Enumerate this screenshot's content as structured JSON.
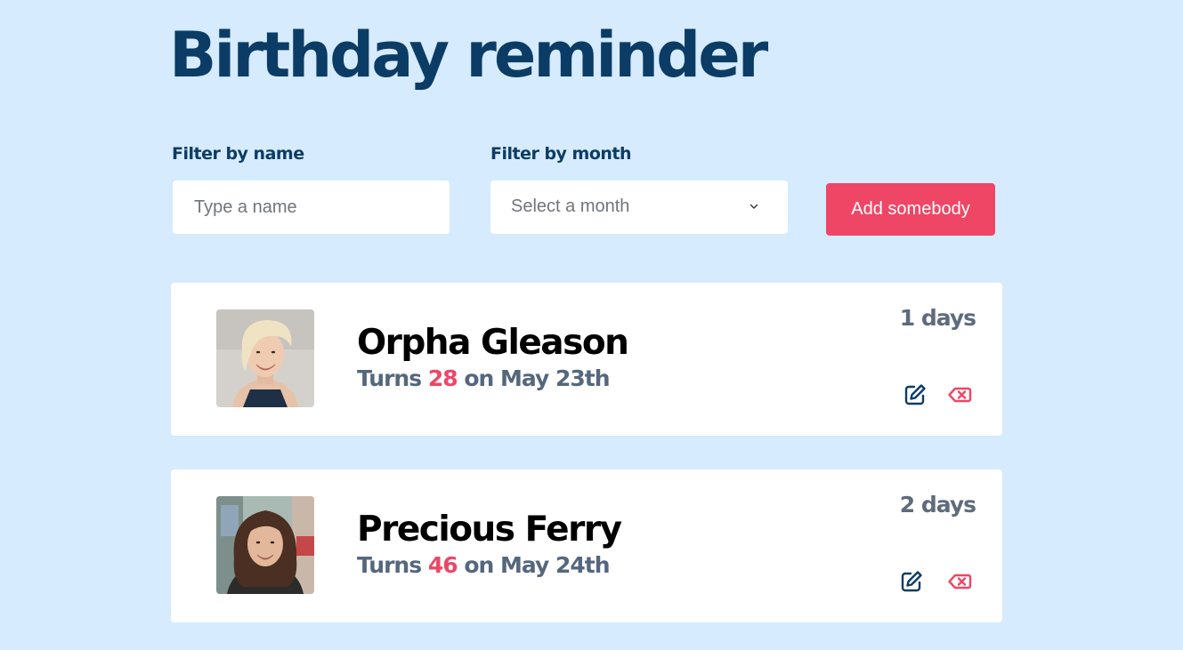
{
  "title": "Birthday reminder",
  "filters": {
    "name_label": "Filter by name",
    "name_placeholder": "Type a name",
    "month_label": "Filter by month",
    "month_placeholder": "Select a month"
  },
  "add_button": "Add somebody",
  "colors": {
    "background": "#d6ebfd",
    "title": "#0b3c66",
    "accent": "#ef4666",
    "edit_icon": "#0b3c66",
    "delete_icon": "#ef4666"
  },
  "people": [
    {
      "name": "Orpha Gleason",
      "turns_prefix": "Turns ",
      "age": "28",
      "date_suffix": " on May 23th",
      "days": "1 days",
      "icons": [
        "edit-icon",
        "delete-icon"
      ]
    },
    {
      "name": "Precious Ferry",
      "turns_prefix": "Turns ",
      "age": "46",
      "date_suffix": " on May 24th",
      "days": "2 days",
      "icons": [
        "edit-icon",
        "delete-icon"
      ]
    }
  ]
}
